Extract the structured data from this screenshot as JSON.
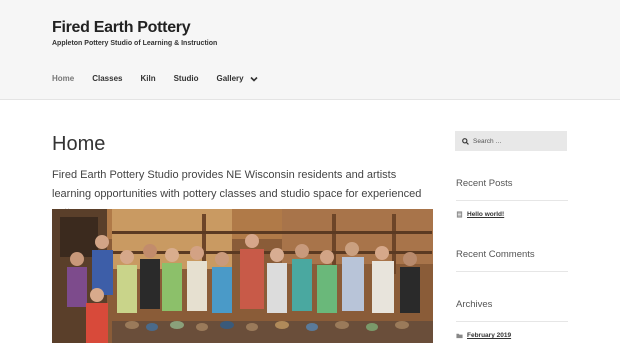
{
  "header": {
    "site_title": "Fired Earth Pottery",
    "tagline": "Appleton Pottery Studio of Learning & Instruction"
  },
  "nav": {
    "items": [
      {
        "label": "Home",
        "active": true
      },
      {
        "label": "Classes"
      },
      {
        "label": "Kiln"
      },
      {
        "label": "Studio"
      },
      {
        "label": "Gallery",
        "has_dropdown": true
      }
    ]
  },
  "main": {
    "title": "Home",
    "intro": "Fired Earth Pottery Studio provides NE Wisconsin residents and artists learning opportunities with pottery classes and studio space for experienced potters."
  },
  "sidebar": {
    "search": {
      "placeholder": "Search …"
    },
    "recent_posts": {
      "title": "Recent Posts",
      "items": [
        "Hello world!"
      ]
    },
    "recent_comments": {
      "title": "Recent Comments"
    },
    "archives": {
      "title": "Archives",
      "items": [
        "February 2019"
      ]
    }
  },
  "colors": {
    "header_bg": "#f6f6f6",
    "text": "#333333",
    "search_bg": "#e8e8e8"
  }
}
